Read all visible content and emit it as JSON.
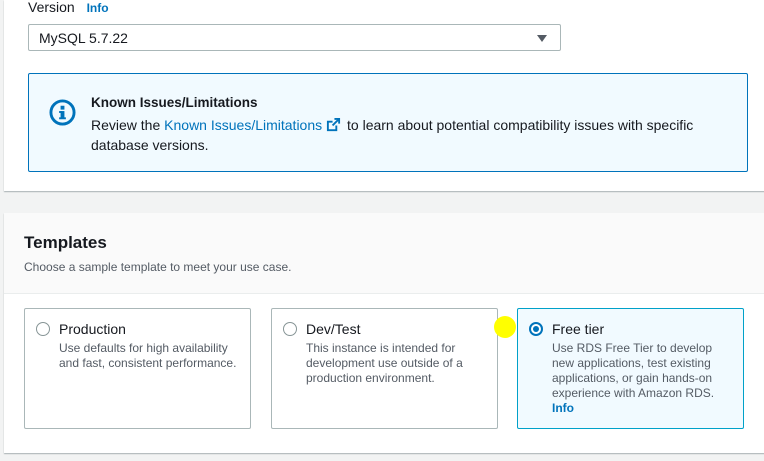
{
  "engine": {
    "version_label": "Version",
    "info_label": "Info",
    "selected_version": "MySQL 5.7.22"
  },
  "alert": {
    "title": "Known Issues/Limitations",
    "body_prefix": "Review the ",
    "link_text": "Known Issues/Limitations",
    "body_suffix": " to learn about potential compatibility issues with specific database versions.",
    "icon": "info-circle-icon",
    "accent_color": "#0073bb"
  },
  "templates": {
    "title": "Templates",
    "description": "Choose a sample template to meet your use case.",
    "options": [
      {
        "label": "Production",
        "description": "Use defaults for high availability and fast, consistent performance.",
        "selected": false
      },
      {
        "label": "Dev/Test",
        "description": "This instance is intended for development use outside of a production environment.",
        "selected": false
      },
      {
        "label": "Free tier",
        "description": "Use RDS Free Tier to develop new applications, test existing applications, or gain hands-on experience with Amazon RDS.",
        "info_label": "Info",
        "selected": true
      }
    ]
  }
}
